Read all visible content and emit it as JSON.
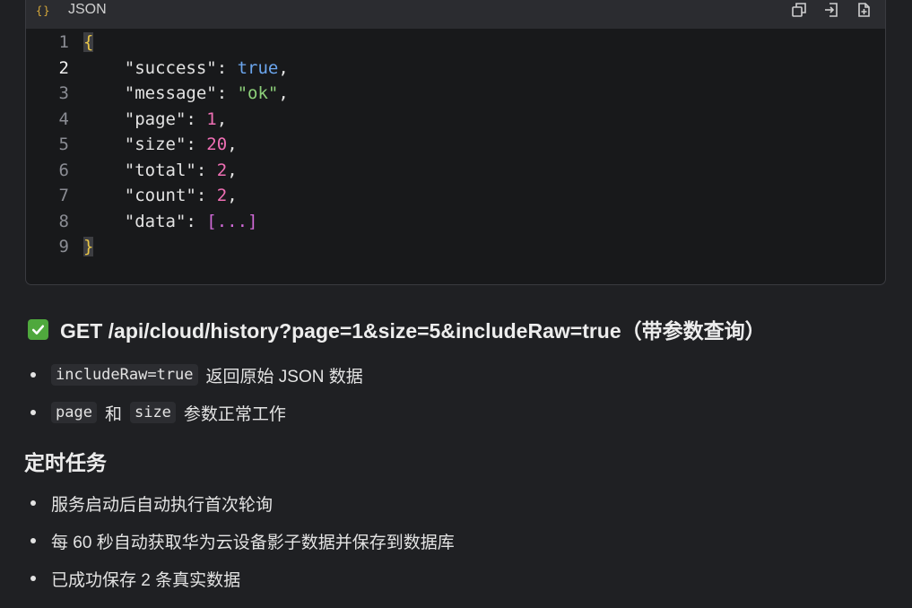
{
  "code_block": {
    "language": "JSON",
    "lang_icon_text": "{}",
    "toolbar": {
      "copy_icon": "copy-icon",
      "insert_icon": "insert-icon",
      "new_file_icon": "new-file-icon"
    },
    "active_line": 2,
    "lines": [
      {
        "number": "1"
      },
      {
        "number": "2"
      },
      {
        "number": "3"
      },
      {
        "number": "4"
      },
      {
        "number": "5"
      },
      {
        "number": "6"
      },
      {
        "number": "7"
      },
      {
        "number": "8"
      },
      {
        "number": "9"
      }
    ],
    "tokens": {
      "open_brace": "{",
      "close_brace": "}",
      "success_key": "\"success\"",
      "success_val": "true",
      "message_key": "\"message\"",
      "message_val": "\"ok\"",
      "page_key": "\"page\"",
      "page_val": "1",
      "size_key": "\"size\"",
      "size_val": "20",
      "total_key": "\"total\"",
      "total_val": "2",
      "count_key": "\"count\"",
      "count_val": "2",
      "data_key": "\"data\"",
      "data_val": "[...]"
    },
    "colors": {
      "brace": "#e8c547",
      "boolean": "#6ba6ee",
      "string": "#8dd07a",
      "number": "#ef6fb4",
      "bracket": "#d16ad8"
    }
  },
  "api_section": {
    "status_icon": "check-icon",
    "status_color": "#4fa83d",
    "heading": "GET /api/cloud/history?page=1&size=5&includeRaw=true（带参数查询）",
    "bullets": [
      {
        "code": "includeRaw=true",
        "text": "返回原始 JSON 数据"
      },
      {
        "code_a": "page",
        "joiner": "和",
        "code_b": "size",
        "text": "参数正常工作"
      }
    ]
  },
  "schedule_section": {
    "title": "定时任务",
    "bullets": [
      "服务启动后自动执行首次轮询",
      "每 60 秒自动获取华为云设备影子数据并保存到数据库",
      "已成功保存 2 条真实数据"
    ]
  }
}
